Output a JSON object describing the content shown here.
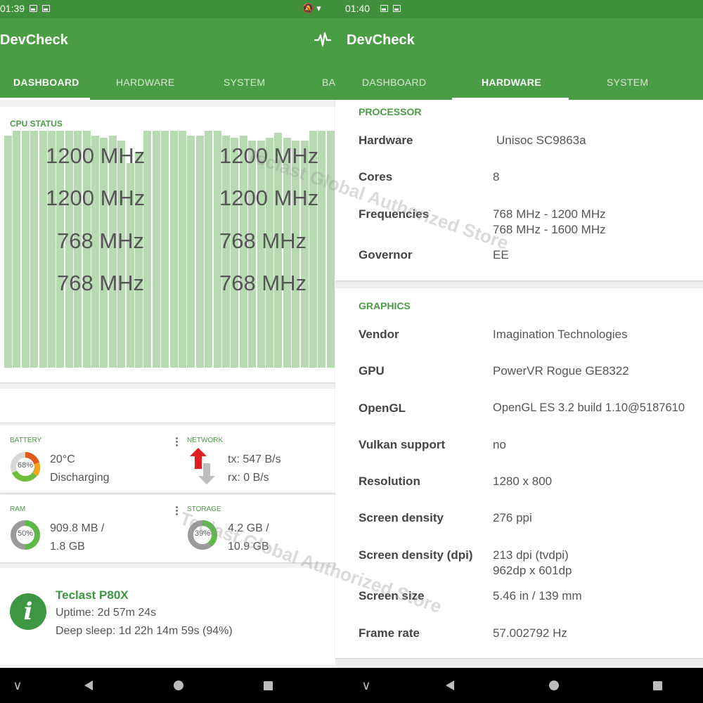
{
  "left": {
    "status": {
      "time": "01:39"
    },
    "app_title": "DevCheck",
    "tabs": [
      "DASHBOARD",
      "HARDWARE",
      "SYSTEM",
      "BA"
    ],
    "cpu": {
      "label": "CPU STATUS",
      "freqs": [
        "1200 MHz",
        "1200 MHz",
        "1200 MHz",
        "1200 MHz",
        "768 MHz",
        "768 MHz",
        "768 MHz",
        "768 MHz"
      ],
      "bar_levels": [
        0.93,
        0.95,
        0.95,
        0.95,
        0.95,
        0.95,
        0.95,
        0.95,
        0.95,
        0.95,
        0.93,
        0.92,
        0.93,
        0.91,
        0.82,
        0.86,
        0.95,
        0.95,
        0.95,
        0.95,
        0.95,
        0.93,
        0.93,
        0.95,
        0.95,
        0.93,
        0.92,
        0.93,
        0.91,
        0.91,
        0.92,
        0.94,
        0.92,
        0.91,
        0.91,
        0.95,
        0.95,
        0.95
      ]
    },
    "battery": {
      "label": "BATTERY",
      "percent": "68%",
      "level": 0.68,
      "temp": "20°C",
      "state": "Discharging"
    },
    "network": {
      "label": "NETWORK",
      "tx": "tx: 547 B/s",
      "rx": "rx: 0 B/s"
    },
    "ram": {
      "label": "RAM",
      "percent": "50%",
      "level": 0.5,
      "line1": "909.8 MB /",
      "line2": "1.8 GB"
    },
    "storage": {
      "label": "STORAGE",
      "percent": "39%",
      "level": 0.39,
      "line1": "4.2 GB /",
      "line2": "10.9 GB"
    },
    "device": {
      "name": "Teclast P80X",
      "uptime": "Uptime: 2d 57m 24s",
      "deep_sleep": "Deep sleep: 1d 22h 14m 59s (94%)"
    }
  },
  "right": {
    "status": {
      "time": "01:40"
    },
    "app_title": "DevCheck",
    "tabs": [
      "DASHBOARD",
      "HARDWARE",
      "SYSTEM"
    ],
    "processor": {
      "title": "PROCESSOR",
      "hardware_key": "Hardware",
      "hardware_val": "Unisoc SC9863a",
      "cores_key": "Cores",
      "cores_val": "8",
      "freq_key": "Frequencies",
      "freq_val1": "768 MHz - 1200 MHz",
      "freq_val2": "768 MHz - 1600 MHz",
      "governor_key": "Governor",
      "governor_val": "EE"
    },
    "graphics": {
      "title": "GRAPHICS",
      "vendor_key": "Vendor",
      "vendor_val": "Imagination Technologies",
      "gpu_key": "GPU",
      "gpu_val": "PowerVR Rogue GE8322",
      "opengl_key": "OpenGL",
      "opengl_val": "OpenGL ES 3.2 build 1.10@5187610",
      "vulkan_key": "Vulkan support",
      "vulkan_val": "no",
      "resolution_key": "Resolution",
      "resolution_val": "1280 x 800",
      "density_key": "Screen density",
      "density_val": "276 ppi",
      "dpi_key": "Screen density (dpi)",
      "dpi_val1": "213 dpi (tvdpi)",
      "dpi_val2": "962dp x 601dp",
      "size_key": "Screen size",
      "size_val": "5.46 in / 139 mm",
      "frame_key": "Frame rate",
      "frame_val": "57.002792 Hz"
    }
  },
  "watermark": "Teclast Global Authorized Store",
  "colors": {
    "primary": "#4a9d44",
    "status_bar": "#3f8f3b",
    "cpu_bar": "#b8dab3",
    "accent_green": "#3d9641"
  }
}
